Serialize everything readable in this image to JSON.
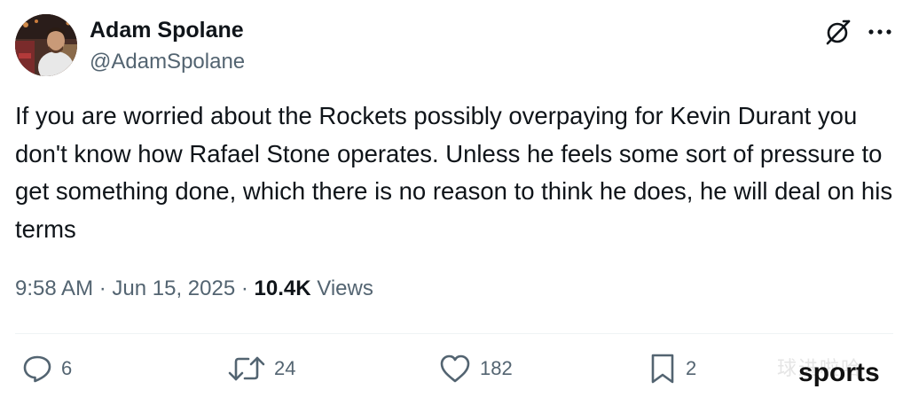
{
  "author": {
    "display_name": "Adam Spolane",
    "handle": "@AdamSpolane"
  },
  "header_icons": {
    "grok": "grok-icon",
    "more": "more-icon"
  },
  "tweet": {
    "text": "If you are worried about the Rockets possibly overpaying for Kevin Durant you don't know how Rafael Stone operates. Unless he feels some sort of pressure to get something done, which there is no reason to think he does, he will deal on his terms"
  },
  "meta": {
    "time": "9:58 AM",
    "separator": "·",
    "date": "Jun 15, 2025",
    "views_count": "10.4K",
    "views_label": "Views"
  },
  "actions": {
    "reply": {
      "icon": "reply-icon",
      "count": "6"
    },
    "retweet": {
      "icon": "retweet-icon",
      "count": "24"
    },
    "like": {
      "icon": "heart-icon",
      "count": "182"
    },
    "bookmark": {
      "icon": "bookmark-icon",
      "count": "2"
    }
  },
  "watermark": {
    "text_cn": "球进啦哈",
    "text_en": "sports"
  },
  "colors": {
    "text_primary": "#0f1419",
    "text_secondary": "#536471",
    "divider": "#eff3f4"
  }
}
